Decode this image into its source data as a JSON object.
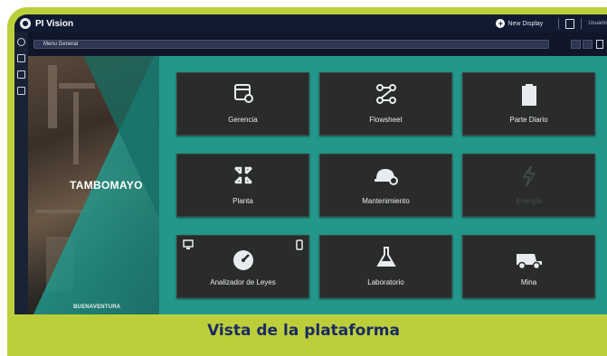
{
  "app": {
    "title": "PI Vision",
    "new_display_label": "New Display",
    "user_label": "Usuario"
  },
  "toolbar": {
    "breadcrumb": "Menu General"
  },
  "brand": {
    "site_name": "TAMBOMAYO",
    "company": "BUENAVENTURA"
  },
  "tiles": [
    {
      "label": "Gerencia",
      "icon": "monitor-gear-icon",
      "enabled": true
    },
    {
      "label": "Flowsheet",
      "icon": "flow-diagram-icon",
      "enabled": true
    },
    {
      "label": "Parte Diario",
      "icon": "clipboard-icon",
      "enabled": true
    },
    {
      "label": "Planta",
      "icon": "arrows-cycle-icon",
      "enabled": true
    },
    {
      "label": "Mantenimiento",
      "icon": "hard-hat-gear-icon",
      "enabled": true
    },
    {
      "label": "Energía",
      "icon": "lightning-icon",
      "enabled": false
    },
    {
      "label": "Analizador de Leyes",
      "icon": "gauge-icon",
      "enabled": true
    },
    {
      "label": "Laboratorio",
      "icon": "flask-icon",
      "enabled": true
    },
    {
      "label": "Mina",
      "icon": "mining-truck-icon",
      "enabled": true
    }
  ],
  "caption": "Vista de la plataforma",
  "colors": {
    "frame": "#bccf3b",
    "canvas": "#22978a",
    "tile": "#2a2b2b",
    "caption_text": "#1b2a63",
    "titlebar": "#101a30"
  }
}
